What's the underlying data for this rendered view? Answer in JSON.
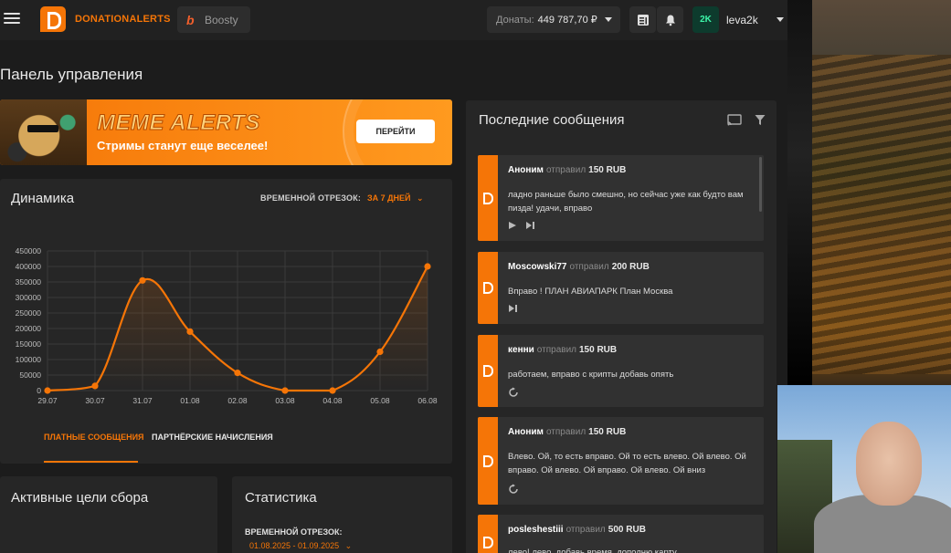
{
  "header": {
    "logo_text": "DONATIONALERTS",
    "boosty_label": "Boosty",
    "donations_label": "Донаты:",
    "donations_value": "449 787,70 ₽",
    "user_avatar_text": "2K",
    "username": "leva2k"
  },
  "page": {
    "title": "Панель управления"
  },
  "banner": {
    "title": "MEME ALERTS",
    "subtitle": "Стримы станут еще веселее!",
    "button_label": "ПЕРЕЙТИ"
  },
  "dynamics": {
    "title": "Динамика",
    "period_label": "ВРЕМЕННОЙ ОТРЕЗОК:",
    "period_value": "ЗА 7 ДНЕЙ",
    "tabs": [
      {
        "label": "ПЛАТНЫЕ СООБЩЕНИЯ",
        "active": true
      },
      {
        "label": "ПАРТНЁРСКИЕ НАЧИСЛЕНИЯ",
        "active": false
      }
    ]
  },
  "chart_data": {
    "type": "line",
    "x": [
      "29.07",
      "30.07",
      "31.07",
      "01.08",
      "02.08",
      "03.08",
      "04.08",
      "05.08",
      "06.08"
    ],
    "values": [
      0,
      15000,
      355000,
      190000,
      57000,
      0,
      0,
      125000,
      400000
    ],
    "ylim": [
      0,
      450000
    ],
    "yticks": [
      "0",
      "50000",
      "100000",
      "150000",
      "200000",
      "250000",
      "300000",
      "350000",
      "400000",
      "450000"
    ],
    "grid": true,
    "color": "#f57507"
  },
  "goals": {
    "title": "Активные цели сбора"
  },
  "stats": {
    "title": "Статистика",
    "period_label": "ВРЕМЕННОЙ ОТРЕЗОК:",
    "period_value": "01.08.2025 - 01.09.2025"
  },
  "messages": {
    "title": "Последние сообщения",
    "verb": "отправил",
    "items": [
      {
        "name": "Аноним",
        "amount": "150 RUB",
        "text": "ладно раньше было смешно, но сейчас уже как будто вам пизда! удачи, вправо"
      },
      {
        "name": "Moscowski77",
        "amount": "200 RUB",
        "text": "Вправо ! ПЛАН АВИАПАРК План Москва"
      },
      {
        "name": "кенни",
        "amount": "150 RUB",
        "text": "работаем, вправо с крипты добавь опять"
      },
      {
        "name": "Аноним",
        "amount": "150 RUB",
        "text": "Влево. Ой, то есть вправо. Ой то есть влево. Ой влево. Ой вправо. Ой влево. Ой вправо. Ой влево. Ой вниз"
      },
      {
        "name": "posleshestiii",
        "amount": "500 RUB",
        "text": "лево! лево, добавь время, дополню карту"
      }
    ]
  },
  "colors": {
    "accent": "#f57507",
    "bg": "#1c1c1c",
    "card": "#262626"
  }
}
